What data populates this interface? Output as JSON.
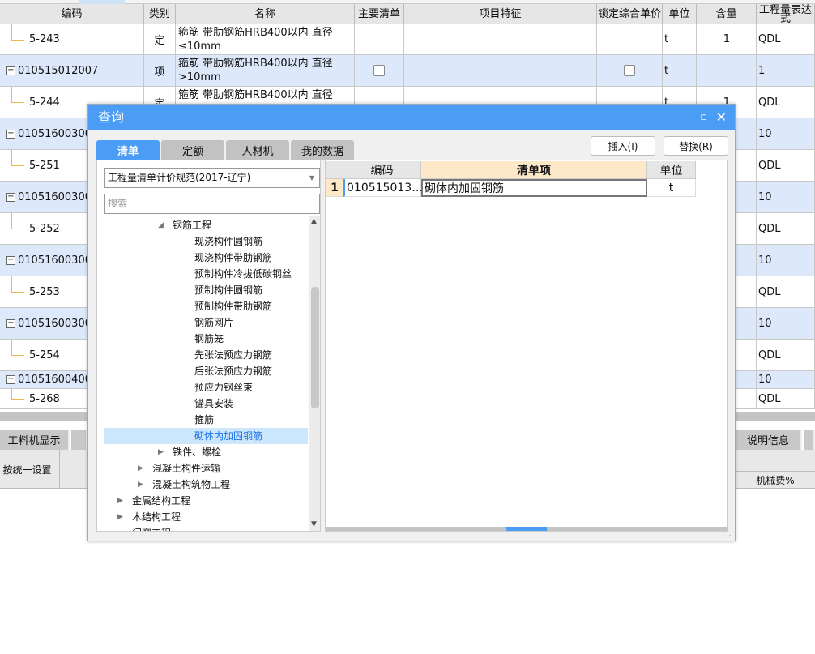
{
  "grid": {
    "columns": [
      "编码",
      "类别",
      "名称",
      "主要清单",
      "项目特征",
      "锁定综合单价",
      "单位",
      "含量",
      "工程量表达式"
    ],
    "rows": [
      {
        "code": "5-243",
        "type": "定",
        "name": "箍筋 带肋钢筋HRB400以内 直径≤10mm",
        "unit": "t",
        "qty": "1",
        "expr": "QDL",
        "level": "child"
      },
      {
        "code": "010515012007",
        "type": "项",
        "name": "箍筋 带肋钢筋HRB400以内 直径>10mm",
        "unit": "t",
        "qty": "",
        "expr": "1",
        "level": "parent"
      },
      {
        "code": "5-244",
        "type": "定",
        "name": "箍筋 带肋钢筋HRB400以内 直径",
        "unit": "t",
        "qty": "1",
        "expr": "QDL",
        "level": "child"
      },
      {
        "code": "01051600300",
        "expr": "10",
        "level": "parent"
      },
      {
        "code": "5-251",
        "expr": "QDL",
        "level": "child"
      },
      {
        "code": "01051600300",
        "expr": "10",
        "level": "parent"
      },
      {
        "code": "5-252",
        "expr": "QDL",
        "level": "child"
      },
      {
        "code": "01051600300",
        "expr": "10",
        "level": "parent"
      },
      {
        "code": "5-253",
        "expr": "QDL",
        "level": "child"
      },
      {
        "code": "01051600300",
        "expr": "10",
        "level": "parent"
      },
      {
        "code": "5-254",
        "expr": "QDL",
        "level": "child"
      },
      {
        "code": "01051600400",
        "expr": "10",
        "level": "parent"
      },
      {
        "code": "5-268",
        "expr": "QDL",
        "level": "child"
      }
    ]
  },
  "bottom": {
    "tab_left": "工料机显示",
    "tab_right": "说明信息",
    "setting": "按统一设置",
    "col_right": "机械费%"
  },
  "dialog": {
    "title": "查询",
    "tabs": [
      "清单",
      "定额",
      "人材机",
      "我的数据"
    ],
    "insert": "插入(I)",
    "replace": "替换(R)",
    "spec": "工程量清单计价规范(2017-辽宁)",
    "search_placeholder": "搜索",
    "tree": [
      {
        "label": "钢筋工程",
        "level": 3,
        "arrow": "expanded"
      },
      {
        "label": "现浇构件圆钢筋",
        "level": 4
      },
      {
        "label": "现浇构件带肋钢筋",
        "level": 4
      },
      {
        "label": "预制构件冷拔低碳钢丝",
        "level": 4
      },
      {
        "label": "预制构件圆钢筋",
        "level": 4
      },
      {
        "label": "预制构件带肋钢筋",
        "level": 4
      },
      {
        "label": "钢筋网片",
        "level": 4
      },
      {
        "label": "钢筋笼",
        "level": 4
      },
      {
        "label": "先张法预应力钢筋",
        "level": 4
      },
      {
        "label": "后张法预应力钢筋",
        "level": 4
      },
      {
        "label": "预应力钢丝束",
        "level": 4
      },
      {
        "label": "锚具安装",
        "level": 4
      },
      {
        "label": "箍筋",
        "level": 4
      },
      {
        "label": "砌体内加固钢筋",
        "level": 4,
        "selected": true
      },
      {
        "label": "铁件、螺栓",
        "level": 3,
        "arrow": "collapsed"
      },
      {
        "label": "混凝土构件运输",
        "level": 2,
        "arrow": "collapsed"
      },
      {
        "label": "混凝土构筑物工程",
        "level": 2,
        "arrow": "collapsed"
      },
      {
        "label": "金属结构工程",
        "level": 1,
        "arrow": "collapsed"
      },
      {
        "label": "木结构工程",
        "level": 1,
        "arrow": "collapsed"
      },
      {
        "label": "门窗工程",
        "level": 1
      }
    ],
    "result": {
      "headers": [
        "编码",
        "清单项",
        "单位"
      ],
      "rows": [
        {
          "num": "1",
          "code": "010515013…",
          "name": "砌体内加固钢筋",
          "unit": "t"
        }
      ]
    }
  },
  "colors": {
    "accent": "#4a9cf4",
    "row_blue": "#dde9fb",
    "selected": "#cce6fb"
  }
}
